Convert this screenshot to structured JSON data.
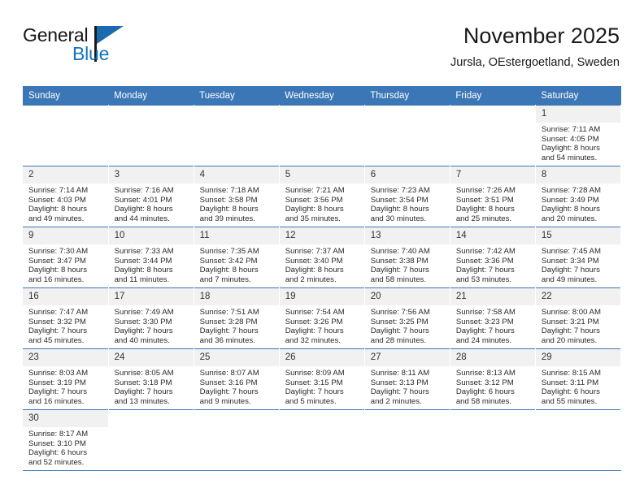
{
  "logo": {
    "word1": "General",
    "word2": "Blue",
    "triangle_color": "#1b69ae",
    "blue_color": "#1274bf"
  },
  "header": {
    "title": "November 2025",
    "subtitle": "Jursla, OEstergoetland, Sweden"
  },
  "theme": {
    "header_blue": "#3b77b6",
    "daynum_band": "#f1f1f1",
    "text": "#222222"
  },
  "calendar": {
    "weekday_headers": [
      "Sunday",
      "Monday",
      "Tuesday",
      "Wednesday",
      "Thursday",
      "Friday",
      "Saturday"
    ],
    "weeks": [
      [
        {
          "day": "",
          "blank": true
        },
        {
          "day": "",
          "blank": true
        },
        {
          "day": "",
          "blank": true
        },
        {
          "day": "",
          "blank": true
        },
        {
          "day": "",
          "blank": true
        },
        {
          "day": "",
          "blank": true
        },
        {
          "day": "1",
          "sunrise": "Sunrise: 7:11 AM",
          "sunset": "Sunset: 4:05 PM",
          "daylight1": "Daylight: 8 hours",
          "daylight2": "and 54 minutes."
        }
      ],
      [
        {
          "day": "2",
          "sunrise": "Sunrise: 7:14 AM",
          "sunset": "Sunset: 4:03 PM",
          "daylight1": "Daylight: 8 hours",
          "daylight2": "and 49 minutes."
        },
        {
          "day": "3",
          "sunrise": "Sunrise: 7:16 AM",
          "sunset": "Sunset: 4:01 PM",
          "daylight1": "Daylight: 8 hours",
          "daylight2": "and 44 minutes."
        },
        {
          "day": "4",
          "sunrise": "Sunrise: 7:18 AM",
          "sunset": "Sunset: 3:58 PM",
          "daylight1": "Daylight: 8 hours",
          "daylight2": "and 39 minutes."
        },
        {
          "day": "5",
          "sunrise": "Sunrise: 7:21 AM",
          "sunset": "Sunset: 3:56 PM",
          "daylight1": "Daylight: 8 hours",
          "daylight2": "and 35 minutes."
        },
        {
          "day": "6",
          "sunrise": "Sunrise: 7:23 AM",
          "sunset": "Sunset: 3:54 PM",
          "daylight1": "Daylight: 8 hours",
          "daylight2": "and 30 minutes."
        },
        {
          "day": "7",
          "sunrise": "Sunrise: 7:26 AM",
          "sunset": "Sunset: 3:51 PM",
          "daylight1": "Daylight: 8 hours",
          "daylight2": "and 25 minutes."
        },
        {
          "day": "8",
          "sunrise": "Sunrise: 7:28 AM",
          "sunset": "Sunset: 3:49 PM",
          "daylight1": "Daylight: 8 hours",
          "daylight2": "and 20 minutes."
        }
      ],
      [
        {
          "day": "9",
          "sunrise": "Sunrise: 7:30 AM",
          "sunset": "Sunset: 3:47 PM",
          "daylight1": "Daylight: 8 hours",
          "daylight2": "and 16 minutes."
        },
        {
          "day": "10",
          "sunrise": "Sunrise: 7:33 AM",
          "sunset": "Sunset: 3:44 PM",
          "daylight1": "Daylight: 8 hours",
          "daylight2": "and 11 minutes."
        },
        {
          "day": "11",
          "sunrise": "Sunrise: 7:35 AM",
          "sunset": "Sunset: 3:42 PM",
          "daylight1": "Daylight: 8 hours",
          "daylight2": "and 7 minutes."
        },
        {
          "day": "12",
          "sunrise": "Sunrise: 7:37 AM",
          "sunset": "Sunset: 3:40 PM",
          "daylight1": "Daylight: 8 hours",
          "daylight2": "and 2 minutes."
        },
        {
          "day": "13",
          "sunrise": "Sunrise: 7:40 AM",
          "sunset": "Sunset: 3:38 PM",
          "daylight1": "Daylight: 7 hours",
          "daylight2": "and 58 minutes."
        },
        {
          "day": "14",
          "sunrise": "Sunrise: 7:42 AM",
          "sunset": "Sunset: 3:36 PM",
          "daylight1": "Daylight: 7 hours",
          "daylight2": "and 53 minutes."
        },
        {
          "day": "15",
          "sunrise": "Sunrise: 7:45 AM",
          "sunset": "Sunset: 3:34 PM",
          "daylight1": "Daylight: 7 hours",
          "daylight2": "and 49 minutes."
        }
      ],
      [
        {
          "day": "16",
          "sunrise": "Sunrise: 7:47 AM",
          "sunset": "Sunset: 3:32 PM",
          "daylight1": "Daylight: 7 hours",
          "daylight2": "and 45 minutes."
        },
        {
          "day": "17",
          "sunrise": "Sunrise: 7:49 AM",
          "sunset": "Sunset: 3:30 PM",
          "daylight1": "Daylight: 7 hours",
          "daylight2": "and 40 minutes."
        },
        {
          "day": "18",
          "sunrise": "Sunrise: 7:51 AM",
          "sunset": "Sunset: 3:28 PM",
          "daylight1": "Daylight: 7 hours",
          "daylight2": "and 36 minutes."
        },
        {
          "day": "19",
          "sunrise": "Sunrise: 7:54 AM",
          "sunset": "Sunset: 3:26 PM",
          "daylight1": "Daylight: 7 hours",
          "daylight2": "and 32 minutes."
        },
        {
          "day": "20",
          "sunrise": "Sunrise: 7:56 AM",
          "sunset": "Sunset: 3:25 PM",
          "daylight1": "Daylight: 7 hours",
          "daylight2": "and 28 minutes."
        },
        {
          "day": "21",
          "sunrise": "Sunrise: 7:58 AM",
          "sunset": "Sunset: 3:23 PM",
          "daylight1": "Daylight: 7 hours",
          "daylight2": "and 24 minutes."
        },
        {
          "day": "22",
          "sunrise": "Sunrise: 8:00 AM",
          "sunset": "Sunset: 3:21 PM",
          "daylight1": "Daylight: 7 hours",
          "daylight2": "and 20 minutes."
        }
      ],
      [
        {
          "day": "23",
          "sunrise": "Sunrise: 8:03 AM",
          "sunset": "Sunset: 3:19 PM",
          "daylight1": "Daylight: 7 hours",
          "daylight2": "and 16 minutes."
        },
        {
          "day": "24",
          "sunrise": "Sunrise: 8:05 AM",
          "sunset": "Sunset: 3:18 PM",
          "daylight1": "Daylight: 7 hours",
          "daylight2": "and 13 minutes."
        },
        {
          "day": "25",
          "sunrise": "Sunrise: 8:07 AM",
          "sunset": "Sunset: 3:16 PM",
          "daylight1": "Daylight: 7 hours",
          "daylight2": "and 9 minutes."
        },
        {
          "day": "26",
          "sunrise": "Sunrise: 8:09 AM",
          "sunset": "Sunset: 3:15 PM",
          "daylight1": "Daylight: 7 hours",
          "daylight2": "and 5 minutes."
        },
        {
          "day": "27",
          "sunrise": "Sunrise: 8:11 AM",
          "sunset": "Sunset: 3:13 PM",
          "daylight1": "Daylight: 7 hours",
          "daylight2": "and 2 minutes."
        },
        {
          "day": "28",
          "sunrise": "Sunrise: 8:13 AM",
          "sunset": "Sunset: 3:12 PM",
          "daylight1": "Daylight: 6 hours",
          "daylight2": "and 58 minutes."
        },
        {
          "day": "29",
          "sunrise": "Sunrise: 8:15 AM",
          "sunset": "Sunset: 3:11 PM",
          "daylight1": "Daylight: 6 hours",
          "daylight2": "and 55 minutes."
        }
      ],
      [
        {
          "day": "30",
          "sunrise": "Sunrise: 8:17 AM",
          "sunset": "Sunset: 3:10 PM",
          "daylight1": "Daylight: 6 hours",
          "daylight2": "and 52 minutes."
        },
        {
          "day": "",
          "blank": true
        },
        {
          "day": "",
          "blank": true
        },
        {
          "day": "",
          "blank": true
        },
        {
          "day": "",
          "blank": true
        },
        {
          "day": "",
          "blank": true
        },
        {
          "day": "",
          "blank": true
        }
      ]
    ]
  }
}
